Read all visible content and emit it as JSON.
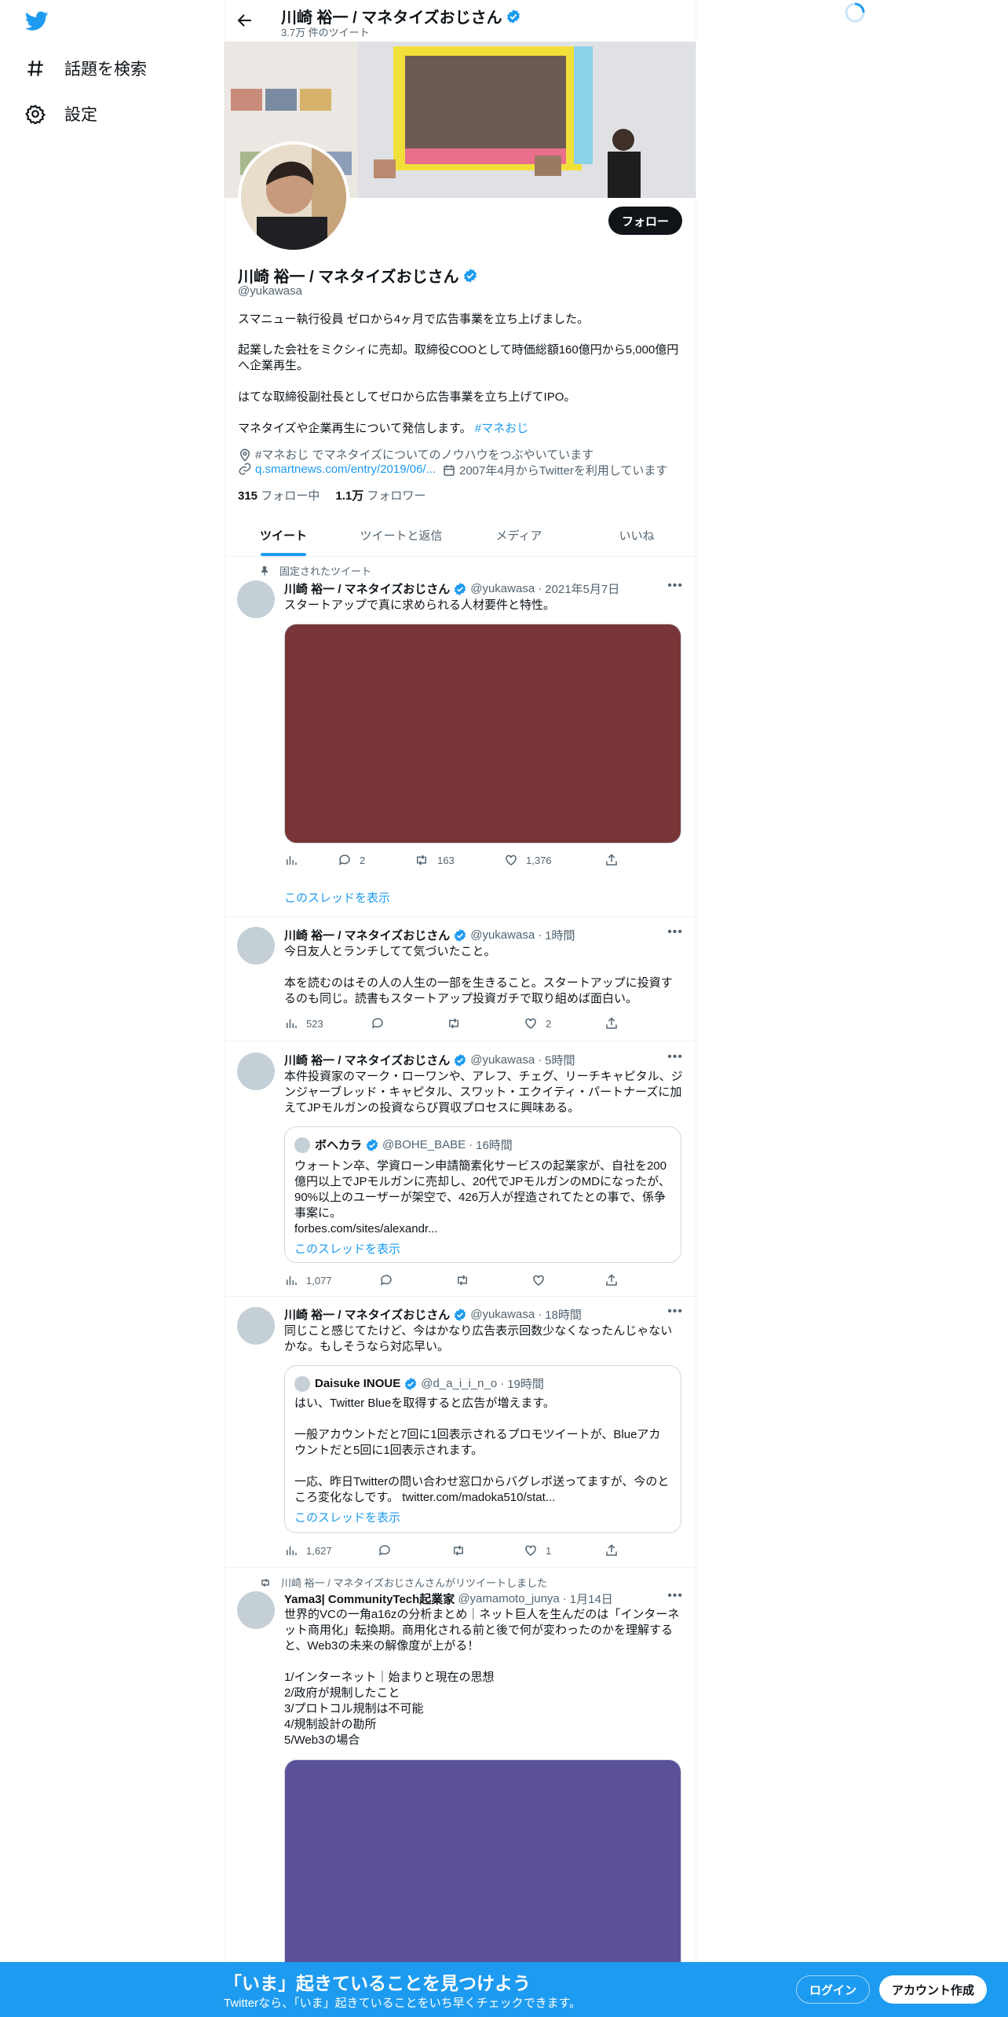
{
  "sidebar": {
    "items": [
      {
        "label": "話題を検索",
        "icon": "hashtag-icon"
      },
      {
        "label": "設定",
        "icon": "gear-icon"
      }
    ]
  },
  "header": {
    "name": "川崎 裕一 / マネタイズおじさん",
    "tweet_count": "3.7万 件のツイート"
  },
  "profile": {
    "name": "川崎 裕一 / マネタイズおじさん",
    "handle": "@yukawasa",
    "follow_label": "フォロー",
    "bio_lines": [
      "スマニュー執行役員 ゼロから4ヶ月で広告事業を立ち上げました。",
      "起業した会社をミクシィに売却。取締役COOとして時価総額160億円から5,000億円へ企業再生。",
      "はてな取締役副社長としてゼロから広告事業を立ち上げてIPO。",
      "マネタイズや企業再生について発信します。"
    ],
    "bio_hashtag": "#マネおじ",
    "location": "#マネおじ でマネタイズについてのノウハウをつぶやいています",
    "url": "q.smartnews.com/entry/2019/06/...",
    "joined": "2007年4月からTwitterを利用しています",
    "following_count": "315",
    "following_label": "フォロー中",
    "followers_count": "1.1万",
    "followers_label": "フォロワー"
  },
  "tabs": [
    "ツイート",
    "ツイートと返信",
    "メディア",
    "いいね"
  ],
  "tweets": [
    {
      "pinned_label": "固定されたツイート",
      "name": "川崎 裕一 / マネタイズおじさん",
      "handle": "@yukawasa",
      "time": "2021年5月7日",
      "text": "スタートアップで真に求められる人材要件と特性。",
      "media_color": "#773537",
      "views": "",
      "replies": "2",
      "retweets": "163",
      "likes": "1,376",
      "show_thread": "このスレッドを表示"
    },
    {
      "name": "川崎 裕一 / マネタイズおじさん",
      "handle": "@yukawasa",
      "time": "1時間",
      "text": "今日友人とランチしてて気づいたこと。\n\n本を読むのはその人の人生の一部を生きること。スタートアップに投資するのも同じ。読書もスタートアップ投資ガチで取り組めば面白い。",
      "views": "523",
      "replies": "",
      "retweets": "",
      "likes": "2"
    },
    {
      "name": "川崎 裕一 / マネタイズおじさん",
      "handle": "@yukawasa",
      "time": "5時間",
      "text": "本件投資家のマーク・ローワンや、アレフ、チェグ、リーチキャピタル、ジンジャーブレッド・キャピタル、スワット・エクイティ・パートナーズに加えてJPモルガンの投資ならび買収プロセスに興味ある。",
      "quote": {
        "name": "ボヘカラ",
        "handle": "@BOHE_BABE",
        "time": "16時間",
        "text": "ウォートン卒、学資ローン申請簡素化サービスの起業家が、自社を200億円以上でJPモルガンに売却し、20代でJPモルガンのMDになったが、90%以上のユーザーが架空で、426万人が捏造されてたとの事で、係争事案に。\nforbes.com/sites/alexandr...",
        "show_thread": "このスレッドを表示"
      },
      "views": "1,077",
      "replies": "",
      "retweets": "",
      "likes": ""
    },
    {
      "name": "川崎 裕一 / マネタイズおじさん",
      "handle": "@yukawasa",
      "time": "18時間",
      "text": "同じこと感じてたけど、今はかなり広告表示回数少なくなったんじゃないかな。もしそうなら対応早い。",
      "quote": {
        "name": "Daisuke INOUE",
        "handle": "@d_a_i_i_n_o",
        "time": "19時間",
        "text": "はい、Twitter Blueを取得すると広告が増えます。\n\n一般アカウントだと7回に1回表示されるプロモツイートが、Blueアカウントだと5回に1回表示されます。\n\n一応、昨日Twitterの問い合わせ窓口からバグレポ送ってますが、今のところ変化なしです。 twitter.com/madoka510/stat...",
        "show_thread": "このスレッドを表示"
      },
      "views": "1,627",
      "replies": "",
      "retweets": "",
      "likes": "1"
    },
    {
      "retweet_label": "川崎 裕一 / マネタイズおじさんさんがリツイートしました",
      "name": "Yama3| CommunityTech起業家",
      "handle": "@yamamoto_junya",
      "time": "1月14日",
      "text": "世界的VCの一角a16zの分析まとめ｜ネット巨人を生んだのは「インターネット商用化」転換期。商用化される前と後で何が変わったのかを理解すると、Web3の未来の解像度が上がる！\n\n1/インターネット｜始まりと現在の思想\n2/政府が規制したこと\n3/プロトコル規制は不可能\n4/規制設計の勘所\n5/Web3の場合",
      "media_color": "#5a5199"
    }
  ],
  "bottom_bar": {
    "title": "「いま」起きていることを見つけよう",
    "subtitle": "Twitterなら、「いま」起きていることをいち早くチェックできます。",
    "login": "ログイン",
    "signup": "アカウント作成"
  },
  "colors": {
    "accent": "#1d9bf0",
    "verified": "#1d9bf0",
    "text": "#0f1419",
    "muted": "#536471"
  }
}
